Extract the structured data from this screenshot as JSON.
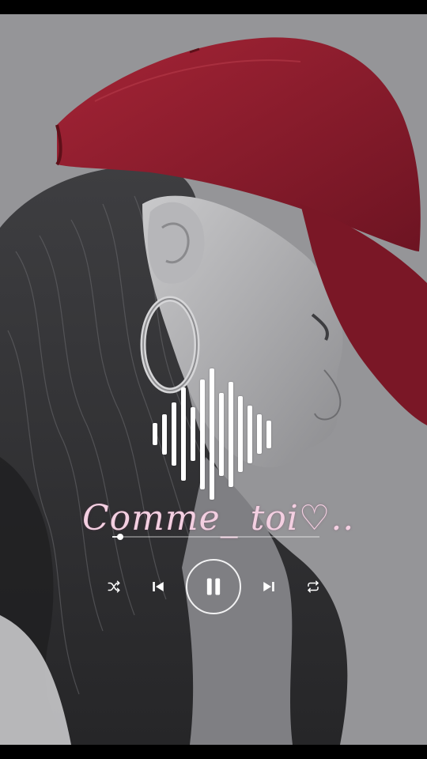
{
  "song": {
    "title": "Comme_ toi♡.."
  },
  "player": {
    "progress_fraction": 0.04,
    "state": "playing",
    "controls": [
      {
        "name": "shuffle",
        "icon": "shuffle-icon"
      },
      {
        "name": "previous",
        "icon": "skip-previous-icon"
      },
      {
        "name": "pause",
        "icon": "pause-icon"
      },
      {
        "name": "next",
        "icon": "skip-next-icon"
      },
      {
        "name": "repeat",
        "icon": "repeat-icon"
      }
    ]
  },
  "visualizer": {
    "levels": [
      0.17,
      0.31,
      0.48,
      0.71,
      0.41,
      0.84,
      1.0,
      0.63,
      0.8,
      0.58,
      0.44,
      0.3,
      0.21
    ]
  },
  "colors": {
    "cap": "#8f1d2d",
    "title_text": "#f3cfe1",
    "controls": "#ffffff",
    "frame": "#000000"
  }
}
